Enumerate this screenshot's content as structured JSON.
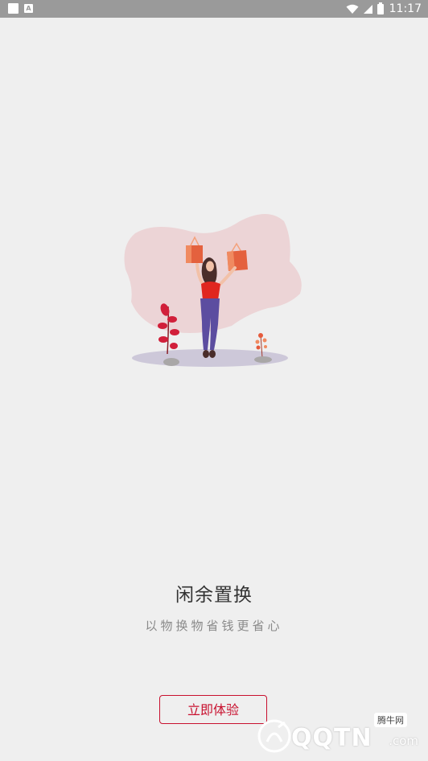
{
  "status_bar": {
    "left_icon_letter": "A",
    "time": "11:17",
    "icons": [
      "notification-square-icon",
      "app-a-icon",
      "wifi-icon",
      "cell-signal-icon",
      "battery-icon"
    ]
  },
  "main": {
    "title": "闲余置换",
    "subtitle": "以物换物省钱更省心",
    "cta_label": "立即体验"
  },
  "colors": {
    "background": "#efefef",
    "accent": "#c8102e",
    "status_bar": "#9a9a9a"
  },
  "watermark": {
    "tag": "腾牛网",
    "brand": "QQTN",
    "suffix": ".com"
  }
}
